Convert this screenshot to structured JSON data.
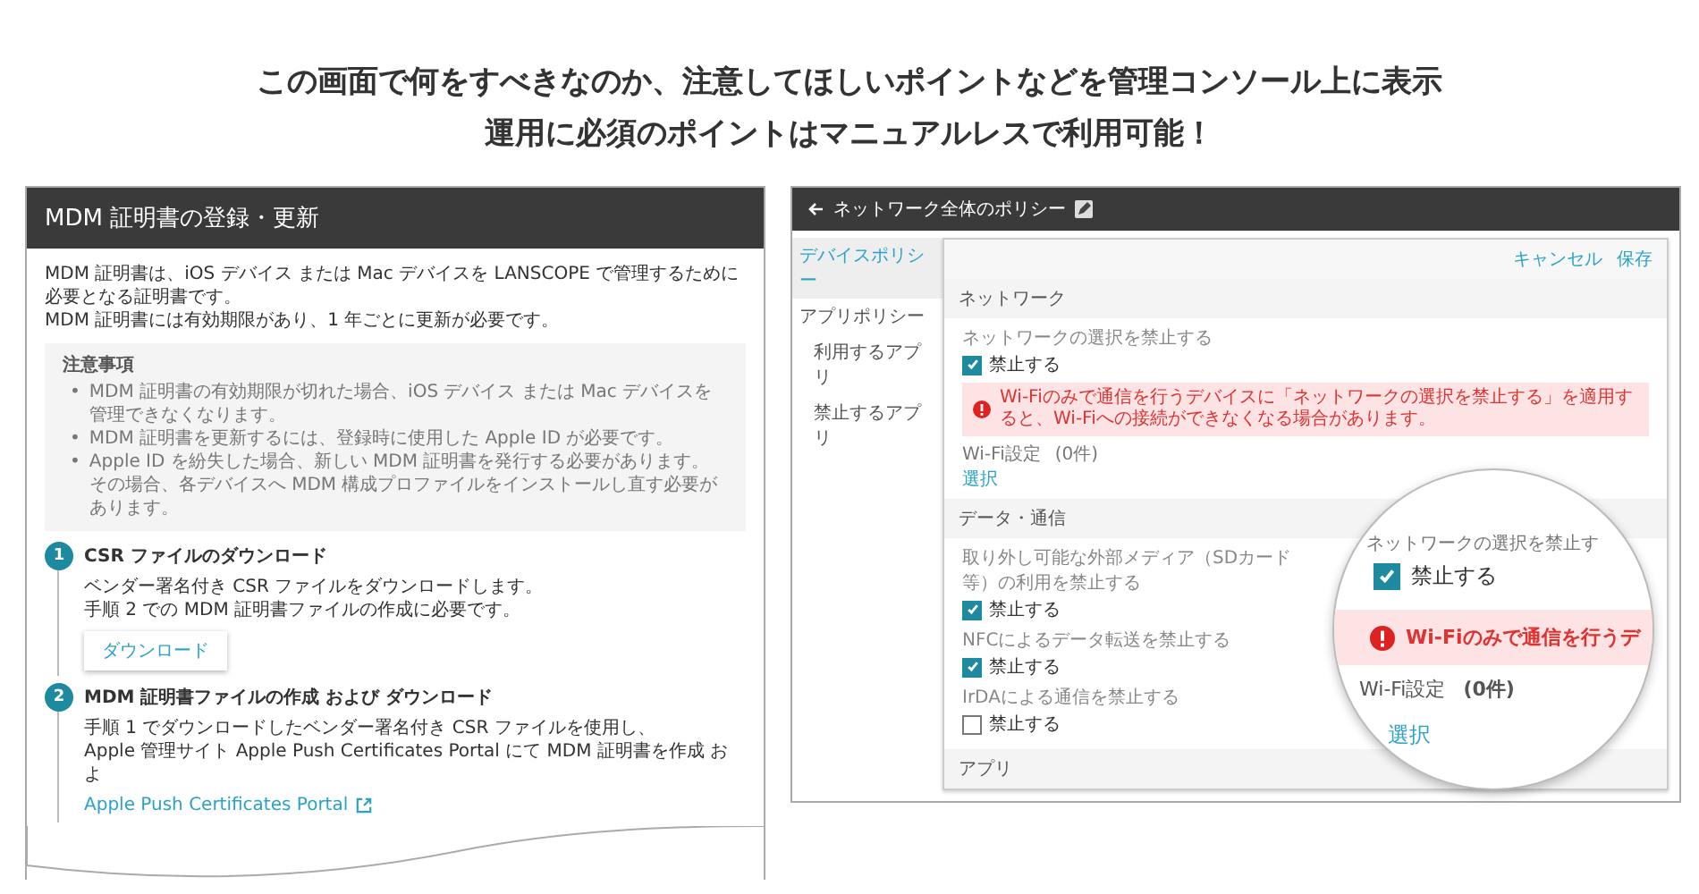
{
  "headline": [
    "この画面で何をすべきなのか、注意してほしいポイントなどを管理コンソール上に表示",
    "運用に必須のポイントはマニュアルレスで利用可能！"
  ],
  "left_screen": {
    "title": "MDM 証明書の登録・更新",
    "intro": [
      "MDM 証明書は、iOS デバイス または Mac デバイスを LANSCOPE で管理するために必要となる証明書です。",
      "MDM 証明書には有効期限があり、1 年ごとに更新が必要です。"
    ],
    "notes": {
      "title": "注意事項",
      "items": [
        {
          "bullet": "•",
          "lines": [
            "MDM 証明書の有効期限が切れた場合、iOS デバイス または Mac デバイスを管理できなくなります。"
          ]
        },
        {
          "bullet": "•",
          "lines": [
            "MDM 証明書を更新するには、登録時に使用した Apple ID が必要です。"
          ]
        },
        {
          "bullet": "•",
          "lines": [
            "Apple ID を紛失した場合、新しい MDM 証明書を発行する必要があります。",
            "その場合、各デバイスへ MDM 構成プロファイルをインストールし直す必要があります。"
          ]
        }
      ]
    },
    "steps": [
      {
        "number": "1",
        "title": "CSR ファイルのダウンロード",
        "lines": [
          "ベンダー署名付き CSR ファイルをダウンロードします。",
          "手順 2 での MDM 証明書ファイルの作成に必要です。"
        ],
        "button": "ダウンロード"
      },
      {
        "number": "2",
        "title": "MDM 証明書ファイルの作成 および ダウンロード",
        "lines": [
          "手順 1 でダウンロードしたベンダー署名付き CSR ファイルを使用し、",
          "Apple 管理サイト Apple Push Certificates Portal にて MDM 証明書を作成 およ"
        ],
        "link": "Apple Push Certificates Portal"
      }
    ]
  },
  "right_screen": {
    "title": "ネットワーク全体のポリシー",
    "sidebar": [
      {
        "label": "デバイスポリシー",
        "selected": true
      },
      {
        "label": "アプリポリシー",
        "selected": false,
        "children": [
          {
            "label": "利用するアプリ",
            "selected": false
          },
          {
            "label": "禁止するアプリ",
            "selected": false
          }
        ]
      }
    ],
    "actions": [
      "キャンセル",
      "保存"
    ],
    "network": {
      "title": "ネットワーク",
      "field_label": "ネットワークの選択を禁止する",
      "checkbox_label": "禁止する",
      "checked": true,
      "alert": "Wi-Fiのみで通信を行うデバイスに「ネットワークの選択を禁止する」を適用すると、Wi-Fiへの接続ができなくなる場合があります。",
      "wifi_label": "Wi-Fi設定",
      "wifi_count": "(0件)",
      "select_link": "選択"
    },
    "data": {
      "title": "データ・通信",
      "items": [
        {
          "label": "取り外し可能な外部メディア（SDカード等）の利用を禁止する",
          "checkbox_label": "禁止する",
          "checked": true
        },
        {
          "label": "NFCによるデータ転送を禁止する",
          "checkbox_label": "禁止する",
          "checked": true
        },
        {
          "label": "IrDAによる通信を禁止する",
          "checkbox_label": "禁止する",
          "checked": false
        }
      ]
    },
    "apps": {
      "title": "アプリ"
    }
  },
  "magnifier": {
    "field_label": "ネットワークの選択を禁止す",
    "checkbox_label": "禁止する",
    "checked": true,
    "alert": "Wi-Fiのみで通信を行うデ",
    "wifi_label": "Wi-Fi設定",
    "wifi_count": "(0件)",
    "select_link": "選択"
  }
}
